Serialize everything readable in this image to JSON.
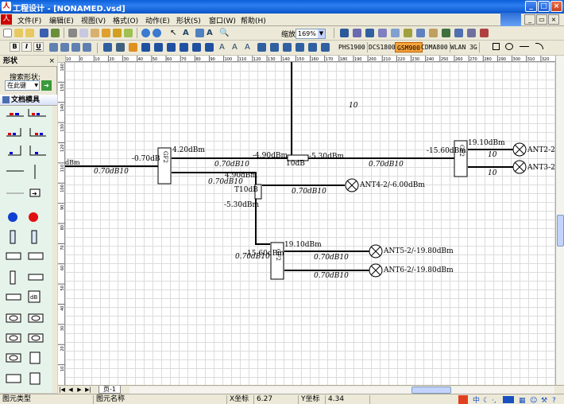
{
  "window": {
    "title": "工程设计 - [NONAMED.vsd]"
  },
  "menu": [
    "文件(F)",
    "编辑(E)",
    "视图(V)",
    "格式(O)",
    "动作(E)",
    "形状(S)",
    "窗口(W)",
    "帮助(H)"
  ],
  "toolbar": {
    "zoom_label": "缩放",
    "zoom_value": "169%",
    "carrier_tabs": [
      "PHS1900",
      "DCS1800",
      "GSM900",
      "CDMA800",
      "WLAN 3G"
    ],
    "active_carrier": "GSM900",
    "format_buttons": [
      "B",
      "I",
      "U"
    ]
  },
  "shapes_pane": {
    "title": "形状",
    "search_label": "搜索形状:",
    "search_scope": "在此键",
    "stencil_title": "文档模具"
  },
  "ruler": {
    "h_ticks": [
      "10",
      "0",
      "10",
      "20",
      "30",
      "40",
      "50",
      "60",
      "70",
      "80",
      "90",
      "100",
      "110",
      "120",
      "130",
      "140",
      "150",
      "160",
      "170",
      "180",
      "190",
      "200",
      "210",
      "220",
      "230",
      "240",
      "250",
      "260",
      "270",
      "280",
      "290",
      "300",
      "310",
      "320"
    ],
    "v_ticks": [
      "160",
      "150",
      "140",
      "130",
      "120",
      "110",
      "100",
      "90",
      "80",
      "70",
      "60",
      "50",
      "40",
      "30",
      "20",
      "10"
    ]
  },
  "diagram": {
    "labels": {
      "top_10": "10",
      "input_dbm": "dBm",
      "input_loss": "0.70dB10",
      "split1_in": "-0.70dB",
      "split1_out": "4.20dBm",
      "split1_id": "GF2",
      "seg_top": "0.70dB10",
      "seg_mid": "0.70dB10",
      "mid_in": "4.90dBm",
      "mid_left": "-4.90dBm",
      "coupler_id": "10dB",
      "coupler_out": "-5.30dBm",
      "tee_id": "T10dB",
      "tee_below": "-5.30dBm",
      "seg_right": "0.70dB10",
      "ant4_seg": "0.70dB10",
      "ant4": "ANT4-2/-6.00dBm",
      "split2_in": "-15.60dBm",
      "split2_out": "19.10dBm",
      "split2_id": "GF2",
      "ant2_loss": "10",
      "ant3_loss": "10",
      "ant2": "ANT2-2.",
      "ant3": "ANT3-2.",
      "lower_in": "-15.60dBm",
      "lower_seg": "0.70dB10",
      "lower_out": "19.10dBm",
      "lower_id": "GF2",
      "ant5_seg": "0.70dB10",
      "ant6_seg": "0.70dB10",
      "ant5": "ANT5-2/-19.80dBm",
      "ant6": "ANT6-2/-19.80dBm"
    }
  },
  "pagetabs": {
    "page1": "页-1"
  },
  "status": {
    "type_label": "图元类型",
    "name_label": "图元名称",
    "x_label": "X坐标",
    "x_value": "6.27",
    "y_label": "Y坐标",
    "y_value": "4.34"
  },
  "colors": {
    "titlebar": "#0a5fd8",
    "accent": "#f8a43c",
    "stencil_bg": "#e6f3ea"
  }
}
